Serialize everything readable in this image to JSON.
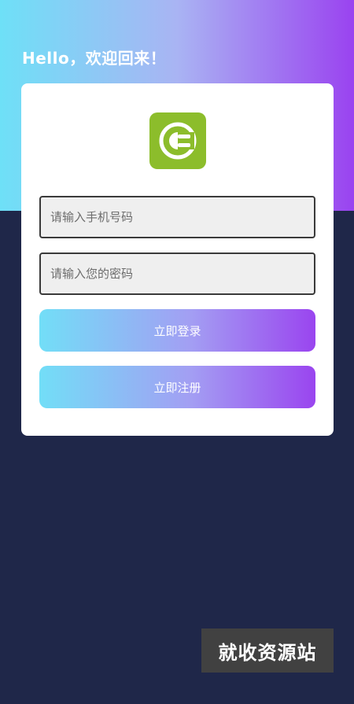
{
  "header": {
    "greeting": "Hello，欢迎回来！"
  },
  "login_form": {
    "logo_icon": "power-plug-icon",
    "phone_placeholder": "请输入手机号码",
    "password_placeholder": "请输入您的密码",
    "login_label": "立即登录",
    "register_label": "立即注册"
  },
  "watermark": {
    "text": "就收资源站"
  },
  "colors": {
    "gradient_start": "#6ee0f7",
    "gradient_end": "#9a43f0",
    "page_background": "#1f2749",
    "logo_green": "#8cbd2b"
  }
}
